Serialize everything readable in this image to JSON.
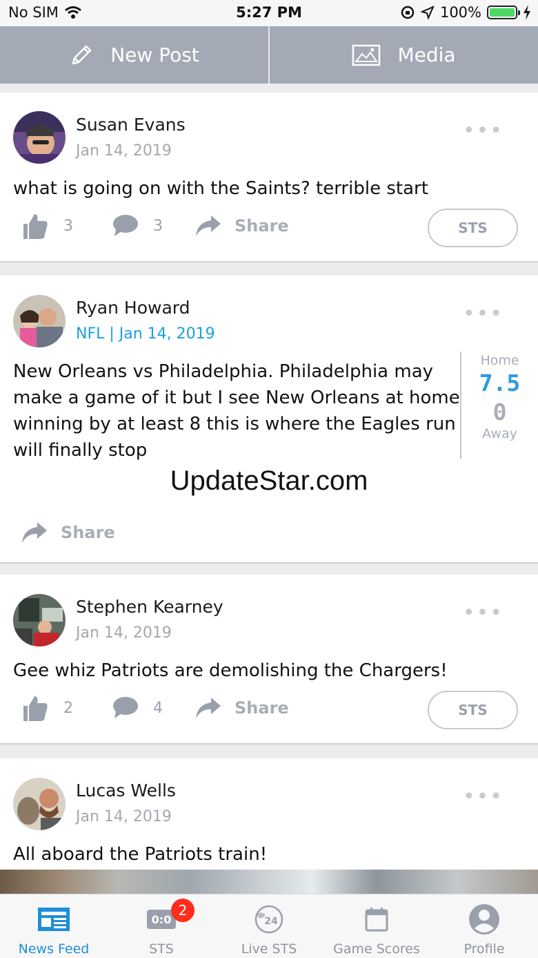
{
  "status_bar": {
    "carrier": "No SIM",
    "time": "5:27 PM",
    "battery": "100%",
    "battery_color": "#4cd964"
  },
  "top_actions": {
    "new_post_label": "New Post",
    "new_post_icon": "pencil-icon",
    "media_label": "Media",
    "media_icon": "image-icon",
    "background": "#a3aab6"
  },
  "posts": [
    {
      "author": "Susan Evans",
      "meta": "Jan 14, 2019",
      "text": "what is going on with the Saints? terrible start",
      "likes": "3",
      "comments": "3",
      "share_label": "Share",
      "sts_label": "STS"
    },
    {
      "author": "Ryan Howard",
      "meta": "NFL | Jan 14, 2019",
      "text": "New Orleans vs Philadelphia. Philadelphia may make a game of it but I see New Orleans at home winning by at least 8 this is where the Eagles run will finally stop",
      "share_label": "Share",
      "score": {
        "home_label": "Home",
        "home_value": "7.5",
        "away_value": "0",
        "away_label": "Away"
      },
      "watermark": "UpdateStar.com"
    },
    {
      "author": "Stephen Kearney",
      "meta": "Jan 14, 2019",
      "text": "Gee whiz Patriots are demolishing the Chargers!",
      "likes": "2",
      "comments": "4",
      "share_label": "Share",
      "sts_label": "STS"
    },
    {
      "author": "Lucas Wells",
      "meta": "Jan 14, 2019",
      "text": "All aboard the Patriots train!"
    }
  ],
  "tab_bar": {
    "tabs": [
      {
        "label": "News Feed",
        "icon": "newspaper-icon",
        "active": true
      },
      {
        "label": "STS",
        "icon": "scoreboard-icon",
        "badge": "2",
        "icon_text": "0:0"
      },
      {
        "label": "Live STS",
        "icon": "globe-24-icon",
        "icon_text": "24"
      },
      {
        "label": "Game Scores",
        "icon": "calendar-icon"
      },
      {
        "label": "Profile",
        "icon": "profile-icon"
      }
    ],
    "active_color": "#1e8fd8",
    "badge_color": "#ff2d1d"
  }
}
